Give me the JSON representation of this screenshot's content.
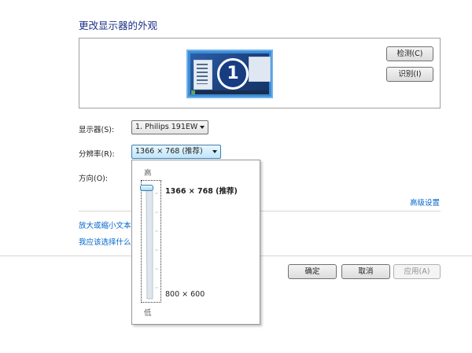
{
  "page": {
    "title": "更改显示器的外观"
  },
  "preview": {
    "monitor_number": "1",
    "detect_button": "检测(C)",
    "identify_button": "识别(I)"
  },
  "settings": {
    "display_label": "显示器(S):",
    "display_value": "1. Philips 191EW",
    "resolution_label": "分辨率(R):",
    "resolution_value": "1366 × 768 (推荐)",
    "orientation_label": "方向(O):",
    "advanced_link": "高级设置"
  },
  "links": {
    "enlarge": "放大或缩小文本",
    "which": "我应该选择什么"
  },
  "footer": {
    "ok_button": "确定",
    "cancel_button": "取消",
    "apply_button": "应用(A)"
  },
  "resolution_popup": {
    "high_label": "高",
    "low_label": "低",
    "max_resolution": "1366 × 768 (推荐)",
    "min_resolution": "800 × 600",
    "slider_value": 1.0
  },
  "colors": {
    "title": "#1e3287",
    "link": "#0066cc",
    "monitor": "#3c8cd6"
  }
}
